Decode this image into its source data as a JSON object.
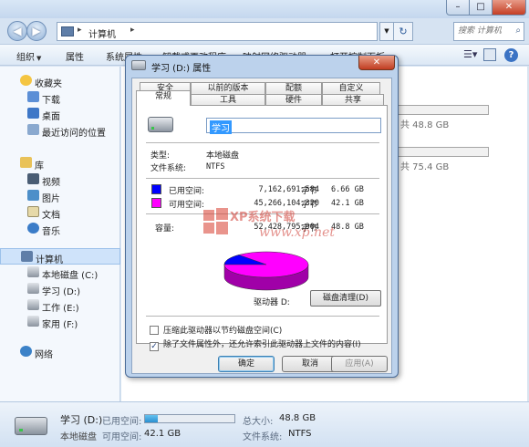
{
  "explorer": {
    "breadcrumb": "计算机",
    "search_placeholder": "搜索 计算机",
    "toolbar": [
      "组织",
      "属性",
      "系统属性",
      "卸载或更改程序",
      "映射网络驱动器",
      "打开控制面板"
    ],
    "nav": {
      "favorites": {
        "header": "收藏夹",
        "items": [
          "下载",
          "桌面",
          "最近访问的位置"
        ]
      },
      "libraries": {
        "header": "库",
        "items": [
          "视频",
          "图片",
          "文档",
          "音乐"
        ]
      },
      "computer": {
        "header": "计算机",
        "items": [
          "本地磁盘 (C:)",
          "学习 (D:)",
          "工作 (E:)",
          "家用 (F:)"
        ]
      },
      "network": "网络"
    },
    "drives_free": [
      "，共 48.8 GB",
      "，共 75.4 GB"
    ],
    "details": {
      "name": "学习 (D:)",
      "type": "本地磁盘",
      "used_label": "已用空间:",
      "free_label": "可用空间:",
      "free_value": "42.1 GB",
      "used_fraction": 0.14,
      "total_label": "总大小:",
      "total_value": "48.8 GB",
      "fs_label": "文件系统:",
      "fs_value": "NTFS"
    }
  },
  "dialog": {
    "title": "学习 (D:) 属性",
    "tabs_row1": [
      "安全",
      "以前的版本",
      "配额",
      "自定义"
    ],
    "tabs_row2": [
      "常规",
      "工具",
      "硬件",
      "共享"
    ],
    "active_tab": "常规",
    "label_value": "学习",
    "type_label": "类型:",
    "type_value": "本地磁盘",
    "fs_label": "文件系统:",
    "fs_value": "NTFS",
    "used": {
      "label": "已用空间:",
      "bytes": "7,162,691,584",
      "unit": "字节",
      "gb": "6.66 GB",
      "color": "#0000ff"
    },
    "free": {
      "label": "可用空间:",
      "bytes": "45,266,104,320",
      "unit": "字节",
      "gb": "42.1 GB",
      "color": "#ff00ff"
    },
    "capacity": {
      "label": "容量:",
      "bytes": "52,428,795,904",
      "unit": "字节",
      "gb": "48.8 GB"
    },
    "used_fraction": 0.1366,
    "drive_caption": "驱动器 D:",
    "cleanup_button": "磁盘清理(D)",
    "compress_label": "压缩此驱动器以节约磁盘空间(C)",
    "compress_checked": false,
    "index_label": "除了文件属性外，还允许索引此驱动器上文件的内容(I)",
    "index_checked": true,
    "ok_button": "确定",
    "cancel_button": "取消",
    "apply_button": "应用(A)"
  },
  "watermark": {
    "brand": "XP系统下载",
    "url": "www.xp.net"
  }
}
